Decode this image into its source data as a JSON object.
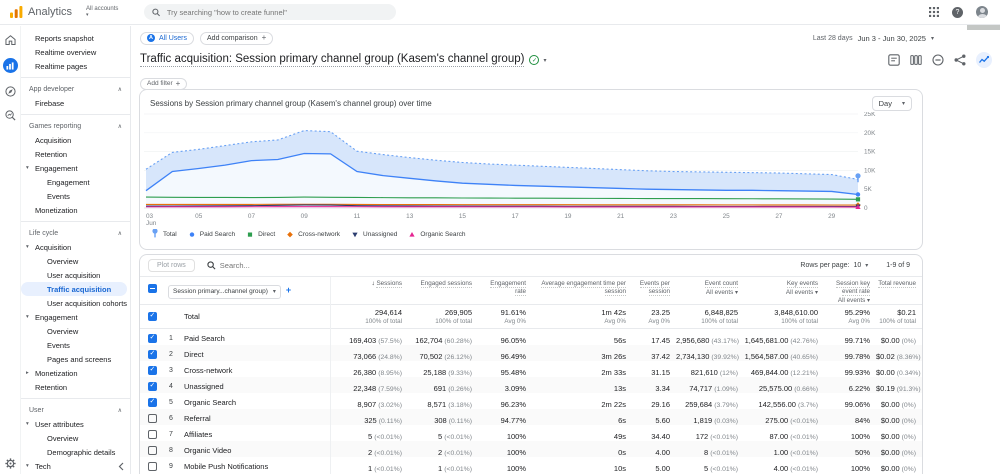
{
  "topbar": {
    "brand": "Analytics",
    "accounts": "All accounts",
    "search_placeholder": "Try searching \"how to create funnel\"",
    "icons": [
      "apps-grid-icon",
      "help-icon",
      "avatar"
    ]
  },
  "rail": {
    "icons": [
      "home-icon",
      "reports-icon",
      "explore-icon",
      "advertising-icon",
      "settings-gear-icon",
      "collapse-chevron-icon"
    ]
  },
  "sidebar": {
    "items": [
      {
        "t": "link",
        "label": "Reports snapshot",
        "indent": 1
      },
      {
        "t": "link",
        "label": "Realtime overview",
        "indent": 1
      },
      {
        "t": "link",
        "label": "Realtime pages",
        "indent": 1
      },
      {
        "t": "divider"
      },
      {
        "t": "header",
        "label": "App developer"
      },
      {
        "t": "link",
        "label": "Firebase",
        "indent": 1
      },
      {
        "t": "divider"
      },
      {
        "t": "header",
        "label": "Games reporting"
      },
      {
        "t": "link",
        "label": "Acquisition",
        "indent": 1
      },
      {
        "t": "link",
        "label": "Retention",
        "indent": 1
      },
      {
        "t": "link",
        "label": "Engagement",
        "indent": 1,
        "arrow": "down"
      },
      {
        "t": "link",
        "label": "Engagement",
        "indent": 2
      },
      {
        "t": "link",
        "label": "Events",
        "indent": 2
      },
      {
        "t": "link",
        "label": "Monetization",
        "indent": 1
      },
      {
        "t": "divider"
      },
      {
        "t": "header",
        "label": "Life cycle"
      },
      {
        "t": "link",
        "label": "Acquisition",
        "indent": 1,
        "arrow": "down"
      },
      {
        "t": "link",
        "label": "Overview",
        "indent": 2
      },
      {
        "t": "link",
        "label": "User acquisition",
        "indent": 2
      },
      {
        "t": "link",
        "label": "Traffic acquisition",
        "indent": 2,
        "active": true
      },
      {
        "t": "link",
        "label": "User acquisition cohorts",
        "indent": 2
      },
      {
        "t": "link",
        "label": "Engagement",
        "indent": 1,
        "arrow": "down"
      },
      {
        "t": "link",
        "label": "Overview",
        "indent": 2
      },
      {
        "t": "link",
        "label": "Events",
        "indent": 2
      },
      {
        "t": "link",
        "label": "Pages and screens",
        "indent": 2
      },
      {
        "t": "link",
        "label": "Monetization",
        "indent": 1,
        "arrow": "right"
      },
      {
        "t": "link",
        "label": "Retention",
        "indent": 1
      },
      {
        "t": "divider"
      },
      {
        "t": "header",
        "label": "User"
      },
      {
        "t": "link",
        "label": "User attributes",
        "indent": 1,
        "arrow": "down"
      },
      {
        "t": "link",
        "label": "Overview",
        "indent": 2
      },
      {
        "t": "link",
        "label": "Demographic details",
        "indent": 2
      },
      {
        "t": "link",
        "label": "Tech",
        "indent": 1,
        "arrow": "down"
      }
    ]
  },
  "report_header": {
    "all_users": "All Users",
    "all_users_badge": "A",
    "add_comparison": "Add comparison",
    "date_preset": "Last 28 days",
    "date_range": "Jun 3 - Jun 30, 2025",
    "title": "Traffic acquisition: Session primary channel group (Kasem's channel group)",
    "add_filter": "Add filter",
    "action_icons": [
      "notes-icon",
      "cards-icon",
      "data-quality-icon",
      "share-icon",
      "insights-icon"
    ]
  },
  "chart_data": {
    "type": "line",
    "title": "Sessions by Session primary channel group (Kasem's channel group) over time",
    "granularity": "Day",
    "x": [
      3,
      4,
      5,
      6,
      7,
      8,
      9,
      10,
      11,
      12,
      13,
      14,
      15,
      16,
      17,
      18,
      19,
      20,
      21,
      22,
      23,
      24,
      25,
      26,
      27,
      28,
      29,
      30
    ],
    "x_month_label": "Jun",
    "x_ticks": [
      3,
      5,
      7,
      9,
      11,
      13,
      15,
      17,
      19,
      21,
      23,
      25,
      27,
      29
    ],
    "ylim": [
      0,
      25000
    ],
    "y_ticks": [
      "0",
      "5K",
      "10K",
      "15K",
      "20K",
      "25K"
    ],
    "legend_position": "bottom",
    "series": [
      {
        "name": "Total",
        "color": "#69a1f4",
        "style": "dotted",
        "marker": "pin",
        "fill": "#d7e6fb",
        "values": [
          10300,
          14800,
          15600,
          16600,
          17600,
          18100,
          20600,
          20300,
          15100,
          14200,
          13400,
          12700,
          12100,
          11700,
          11400,
          11100,
          10800,
          10500,
          10200,
          9900,
          9700,
          9600,
          9500,
          9400,
          9300,
          9100,
          8900,
          7600
        ]
      },
      {
        "name": "Paid Search",
        "color": "#3e82f7",
        "style": "solid",
        "marker": "circle",
        "fill": "#f4f9fe",
        "values": [
          4600,
          9700,
          10500,
          11400,
          12600,
          12900,
          14500,
          14400,
          9700,
          8600,
          7900,
          7200,
          6600,
          6300,
          6000,
          5800,
          5600,
          5400,
          5200,
          5000,
          4900,
          4800,
          4700,
          4700,
          4600,
          4500,
          4400,
          3600
        ]
      },
      {
        "name": "Direct",
        "color": "#2e9e4f",
        "style": "solid",
        "marker": "square",
        "values": [
          2900,
          2850,
          2800,
          2800,
          2780,
          2820,
          2900,
          2850,
          2800,
          2760,
          2720,
          2700,
          2660,
          2640,
          2620,
          2600,
          2580,
          2560,
          2540,
          2520,
          2500,
          2500,
          2480,
          2460,
          2440,
          2420,
          2380,
          2300
        ]
      },
      {
        "name": "Cross-network",
        "color": "#e8710a",
        "style": "solid",
        "marker": "diamond",
        "values": [
          950,
          940,
          940,
          950,
          960,
          980,
          1000,
          990,
          950,
          930,
          920,
          910,
          900,
          890,
          880,
          880,
          870,
          860,
          850,
          850,
          840,
          840,
          830,
          830,
          820,
          810,
          800,
          780
        ]
      },
      {
        "name": "Unassigned",
        "color": "#2c3e70",
        "style": "solid",
        "marker": "triangle-down",
        "values": [
          520,
          530,
          550,
          570,
          620,
          720,
          820,
          790,
          620,
          570,
          545,
          525,
          505,
          495,
          485,
          475,
          465,
          458,
          452,
          445,
          440,
          435,
          430,
          425,
          420,
          415,
          410,
          395
        ]
      },
      {
        "name": "Organic Search",
        "color": "#e52592",
        "style": "solid",
        "marker": "triangle-up",
        "values": [
          300,
          310,
          315,
          320,
          330,
          340,
          350,
          345,
          330,
          325,
          318,
          312,
          308,
          302,
          300,
          298,
          295,
          292,
          290,
          288,
          285,
          282,
          280,
          278,
          275,
          272,
          268,
          255
        ]
      }
    ]
  },
  "table": {
    "plot_rows": "Plot rows",
    "search_placeholder": "Search...",
    "rows_per_page_label": "Rows per page:",
    "rows_per_page": "10",
    "pagination": "1-9 of 9",
    "dimension_selector": "Session primary...channel group)",
    "columns": [
      {
        "label": "Sessions",
        "sorted": true
      },
      {
        "label": "Engaged sessions"
      },
      {
        "label": "Engagement rate"
      },
      {
        "label": "Average engagement time per session"
      },
      {
        "label": "Events per session"
      },
      {
        "label": "Event count",
        "sub": "All events"
      },
      {
        "label": "Key events",
        "sub": "All events"
      },
      {
        "label": "Session key event rate",
        "sub": "All events"
      },
      {
        "label": "Total revenue"
      }
    ],
    "totals": {
      "label": "Total",
      "cells": [
        [
          "294,614",
          "100% of total"
        ],
        [
          "269,905",
          "100% of total"
        ],
        [
          "91.61%",
          "Avg 0%"
        ],
        [
          "1m 42s",
          "Avg 0%"
        ],
        [
          "23.25",
          "Avg 0%"
        ],
        [
          "6,848,825",
          "100% of total"
        ],
        [
          "3,848,610.00",
          "100% of total"
        ],
        [
          "95.29%",
          "Avg 0%"
        ],
        [
          "$0.21",
          "100% of total"
        ]
      ]
    },
    "rows": [
      {
        "num": "1",
        "name": "Paid Search",
        "checked": true,
        "cells": [
          [
            "169,403",
            "(57.5%)"
          ],
          [
            "162,704",
            "(60.28%)"
          ],
          [
            "96.05%",
            ""
          ],
          [
            "56s",
            ""
          ],
          [
            "17.45",
            ""
          ],
          [
            "2,956,680",
            "(43.17%)"
          ],
          [
            "1,645,681.00",
            "(42.76%)"
          ],
          [
            "99.71%",
            ""
          ],
          [
            "$0.00",
            "(0%)"
          ]
        ]
      },
      {
        "num": "2",
        "name": "Direct",
        "checked": true,
        "cells": [
          [
            "73,066",
            "(24.8%)"
          ],
          [
            "70,502",
            "(26.12%)"
          ],
          [
            "96.49%",
            ""
          ],
          [
            "3m 26s",
            ""
          ],
          [
            "37.42",
            ""
          ],
          [
            "2,734,130",
            "(39.92%)"
          ],
          [
            "1,564,587.00",
            "(40.65%)"
          ],
          [
            "99.78%",
            ""
          ],
          [
            "$0.02",
            "(8.36%)"
          ]
        ]
      },
      {
        "num": "3",
        "name": "Cross-network",
        "checked": true,
        "cells": [
          [
            "26,380",
            "(8.95%)"
          ],
          [
            "25,188",
            "(9.33%)"
          ],
          [
            "95.48%",
            ""
          ],
          [
            "2m 33s",
            ""
          ],
          [
            "31.15",
            ""
          ],
          [
            "821,610",
            "(12%)"
          ],
          [
            "469,844.00",
            "(12.21%)"
          ],
          [
            "99.93%",
            ""
          ],
          [
            "$0.00",
            "(0.34%)"
          ]
        ]
      },
      {
        "num": "4",
        "name": "Unassigned",
        "checked": true,
        "cells": [
          [
            "22,348",
            "(7.59%)"
          ],
          [
            "691",
            "(0.26%)"
          ],
          [
            "3.09%",
            ""
          ],
          [
            "13s",
            ""
          ],
          [
            "3.34",
            ""
          ],
          [
            "74,717",
            "(1.09%)"
          ],
          [
            "25,575.00",
            "(0.66%)"
          ],
          [
            "6.22%",
            ""
          ],
          [
            "$0.19",
            "(91.3%)"
          ]
        ]
      },
      {
        "num": "5",
        "name": "Organic Search",
        "checked": true,
        "cells": [
          [
            "8,907",
            "(3.02%)"
          ],
          [
            "8,571",
            "(3.18%)"
          ],
          [
            "96.23%",
            ""
          ],
          [
            "2m 22s",
            ""
          ],
          [
            "29.16",
            ""
          ],
          [
            "259,684",
            "(3.79%)"
          ],
          [
            "142,556.00",
            "(3.7%)"
          ],
          [
            "99.06%",
            ""
          ],
          [
            "$0.00",
            "(0%)"
          ]
        ]
      },
      {
        "num": "6",
        "name": "Referral",
        "checked": false,
        "cells": [
          [
            "325",
            "(0.11%)"
          ],
          [
            "308",
            "(0.11%)"
          ],
          [
            "94.77%",
            ""
          ],
          [
            "6s",
            ""
          ],
          [
            "5.60",
            ""
          ],
          [
            "1,819",
            "(0.03%)"
          ],
          [
            "275.00",
            "(<0.01%)"
          ],
          [
            "84%",
            ""
          ],
          [
            "$0.00",
            "(0%)"
          ]
        ]
      },
      {
        "num": "7",
        "name": "Affiliates",
        "checked": false,
        "cells": [
          [
            "5",
            "(<0.01%)"
          ],
          [
            "5",
            "(<0.01%)"
          ],
          [
            "100%",
            ""
          ],
          [
            "49s",
            ""
          ],
          [
            "34.40",
            ""
          ],
          [
            "172",
            "(<0.01%)"
          ],
          [
            "87.00",
            "(<0.01%)"
          ],
          [
            "100%",
            ""
          ],
          [
            "$0.00",
            "(0%)"
          ]
        ]
      },
      {
        "num": "8",
        "name": "Organic Video",
        "checked": false,
        "cells": [
          [
            "2",
            "(<0.01%)"
          ],
          [
            "2",
            "(<0.01%)"
          ],
          [
            "100%",
            ""
          ],
          [
            "0s",
            ""
          ],
          [
            "4.00",
            ""
          ],
          [
            "8",
            "(<0.01%)"
          ],
          [
            "1.00",
            "(<0.01%)"
          ],
          [
            "50%",
            ""
          ],
          [
            "$0.00",
            "(0%)"
          ]
        ]
      },
      {
        "num": "9",
        "name": "Mobile Push Notifications",
        "checked": false,
        "cells": [
          [
            "1",
            "(<0.01%)"
          ],
          [
            "1",
            "(<0.01%)"
          ],
          [
            "100%",
            ""
          ],
          [
            "10s",
            ""
          ],
          [
            "5.00",
            ""
          ],
          [
            "5",
            "(<0.01%)"
          ],
          [
            "4.00",
            "(<0.01%)"
          ],
          [
            "100%",
            ""
          ],
          [
            "$0.00",
            "(0%)"
          ]
        ]
      }
    ]
  }
}
